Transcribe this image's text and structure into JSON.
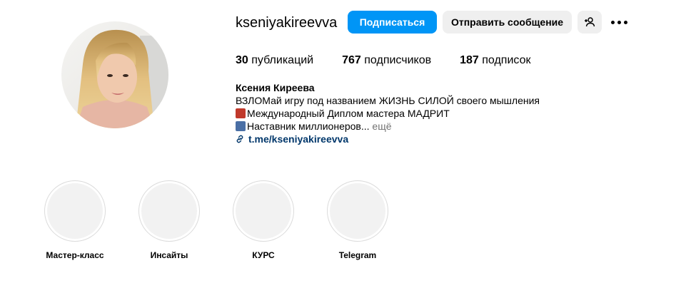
{
  "profile": {
    "username": "kseniyakireevva",
    "full_name": "Ксения Киреева",
    "avatar_alt": "avatar"
  },
  "actions": {
    "follow_label": "Подписаться",
    "message_label": "Отправить сообщение",
    "suggest_icon": "person-plus-icon",
    "more_icon": "more-horizontal-icon"
  },
  "stats": {
    "posts_count": "30",
    "posts_label": "публикаций",
    "followers_count": "767",
    "followers_label": "подписчиков",
    "following_count": "187",
    "following_label": "подписок"
  },
  "bio": {
    "line1": "ВЗЛОМай игру под названием ЖИЗНЬ СИЛОЙ своего мышления",
    "line2": "Международный Диплом мастера МАДРИТ",
    "line3": "Наставник миллионеров...",
    "more_label": "ещё",
    "link": "t.me/kseniyakireevva"
  },
  "highlights": [
    {
      "label": "Мастер-класс"
    },
    {
      "label": "Инсайты"
    },
    {
      "label": "КУРС"
    },
    {
      "label": "Telegram"
    }
  ],
  "colors": {
    "primary_button": "#0095f6",
    "secondary_button": "#efefef",
    "link": "#00376b",
    "muted": "#737373"
  }
}
